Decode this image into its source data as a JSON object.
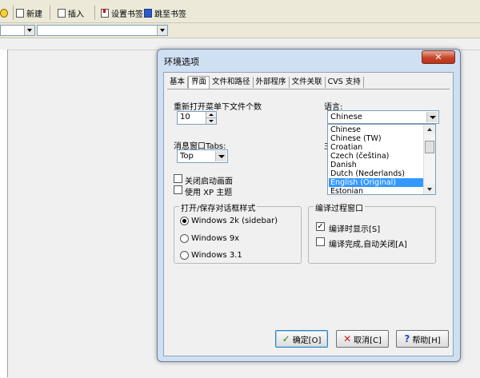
{
  "toolbar": {
    "new_label": "新建",
    "insert_label": "插入",
    "set_bookmark_label": "设置书签",
    "goto_bookmark_label": "跳至书签"
  },
  "dialog": {
    "title": "环境选项",
    "close_glyph": "✕",
    "tabs": [
      {
        "label": "基本"
      },
      {
        "label": "界面"
      },
      {
        "label": "文件和路径"
      },
      {
        "label": "外部程序"
      },
      {
        "label": "文件关联"
      },
      {
        "label": "CVS 支持"
      }
    ],
    "recent_files": {
      "label": "重新打开菜单下文件个数",
      "value": "10"
    },
    "msg_tabs": {
      "label": "消息窗口Tabs:",
      "value": "Top"
    },
    "close_splash": {
      "label": "关闭启动画面",
      "checked": false
    },
    "use_xp_theme": {
      "label": "使用 XP 主题",
      "checked": false
    },
    "dialog_style": {
      "title": "打开/保存对话框样式",
      "options": [
        {
          "label": "Windows 2k (sidebar)",
          "selected": true
        },
        {
          "label": "Windows 9x",
          "selected": false
        },
        {
          "label": "Windows 3.1",
          "selected": false
        }
      ]
    },
    "language": {
      "label": "语言:",
      "value": "Chinese",
      "options": [
        {
          "label": "Chinese"
        },
        {
          "label": "Chinese (TW)"
        },
        {
          "label": "Croatian"
        },
        {
          "label": "Czech (čeština)"
        },
        {
          "label": "Danish"
        },
        {
          "label": "Dutch (Nederlands)"
        },
        {
          "label": "English (Original)",
          "selected": true
        },
        {
          "label": "Estonian"
        }
      ]
    },
    "obscured_label": "主",
    "compile_window": {
      "title": "编译过程窗口",
      "show_on_compile": {
        "label": "编译时显示[S]",
        "checked": true
      },
      "auto_close": {
        "label": "编译完成,自动关闭[A]",
        "checked": false
      }
    },
    "buttons": {
      "ok": "确定[O]",
      "cancel": "取消[C]",
      "help": "帮助[H]"
    },
    "check_glyph": "✓"
  }
}
